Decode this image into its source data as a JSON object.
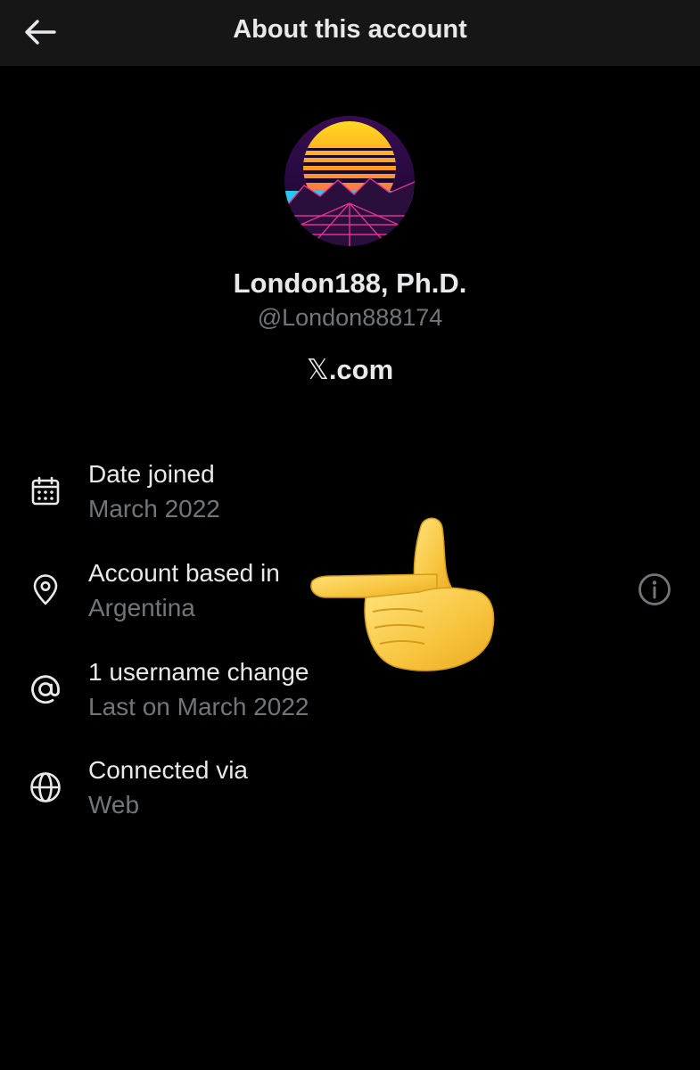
{
  "header": {
    "title": "About this account",
    "back_icon": "arrow-left-icon"
  },
  "profile": {
    "display_name": "London188, Ph.D.",
    "handle": "@London888174",
    "brand_x": "𝕏",
    "brand_suffix": ".com"
  },
  "details": [
    {
      "icon": "calendar-icon",
      "title": "Date joined",
      "value": "March 2022"
    },
    {
      "icon": "location-pin-icon",
      "title": "Account based in",
      "value": "Argentina"
    },
    {
      "icon": "at-sign-icon",
      "title": "1 username change",
      "value": "Last on March 2022"
    },
    {
      "icon": "globe-icon",
      "title": "Connected via",
      "value": "Web"
    }
  ],
  "colors": {
    "background": "#000000",
    "topbar": "#161616",
    "primary_text": "#e7e9ea",
    "secondary_text": "#71767b",
    "emoji_yellow": "#f5c842"
  },
  "overlay": {
    "emoji": "backhand-index-pointing-left-emoji"
  }
}
